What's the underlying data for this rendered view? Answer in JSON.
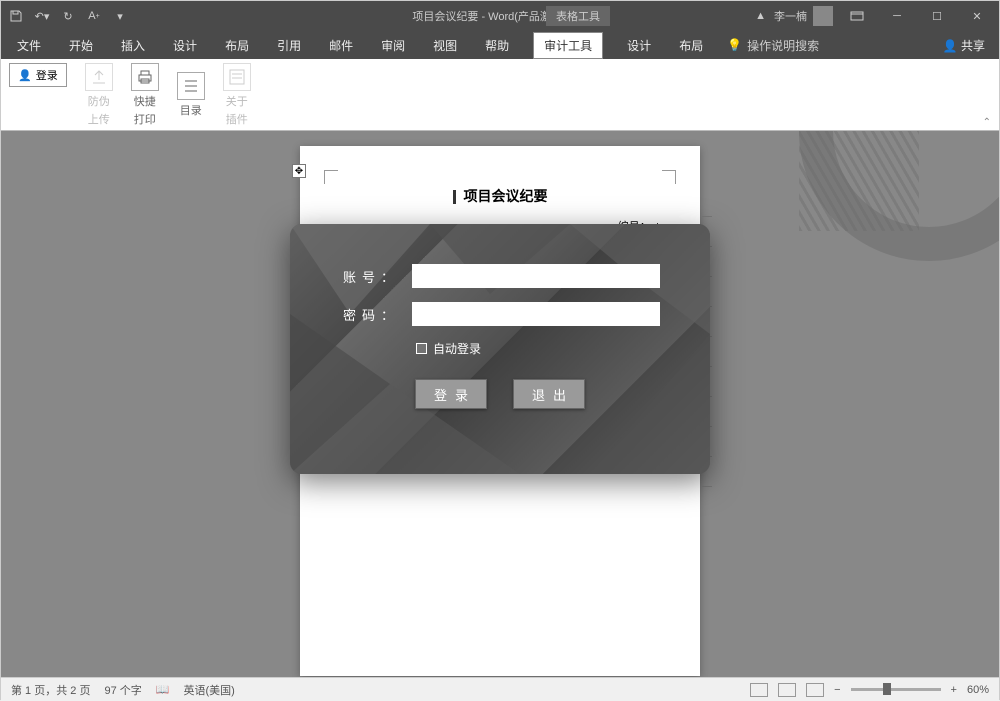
{
  "titlebar": {
    "doc_title": "项目会议纪要 - Word(产品激活失败)",
    "context_tab": "表格工具",
    "username": "李一楠",
    "warn_icon": "warning-icon"
  },
  "tabs": {
    "items": [
      "文件",
      "开始",
      "插入",
      "设计",
      "布局",
      "引用",
      "邮件",
      "审阅",
      "视图",
      "帮助",
      "审计工具",
      "设计",
      "布局"
    ],
    "tell_me": "操作说明搜索",
    "share": "共享"
  },
  "ribbon": {
    "login_small": "登录",
    "btns": [
      {
        "label1": "防伪",
        "label2": "上传",
        "disabled": true
      },
      {
        "label1": "快捷",
        "label2": "打印",
        "disabled": false
      },
      {
        "label1": "目录",
        "label2": "",
        "disabled": false
      },
      {
        "label1": "关于",
        "label2": "插件",
        "disabled": true
      }
    ]
  },
  "document": {
    "title": "项目会议纪要",
    "number_label": "编号："
  },
  "dialog": {
    "account_label": "账号",
    "password_label": "密码",
    "auto_login": "自动登录",
    "login_btn": "登录",
    "exit_btn": "退出"
  },
  "status": {
    "page": "第 1 页，共 2 页",
    "words": "97 个字",
    "lang": "英语(美国)",
    "zoom": "60%"
  }
}
